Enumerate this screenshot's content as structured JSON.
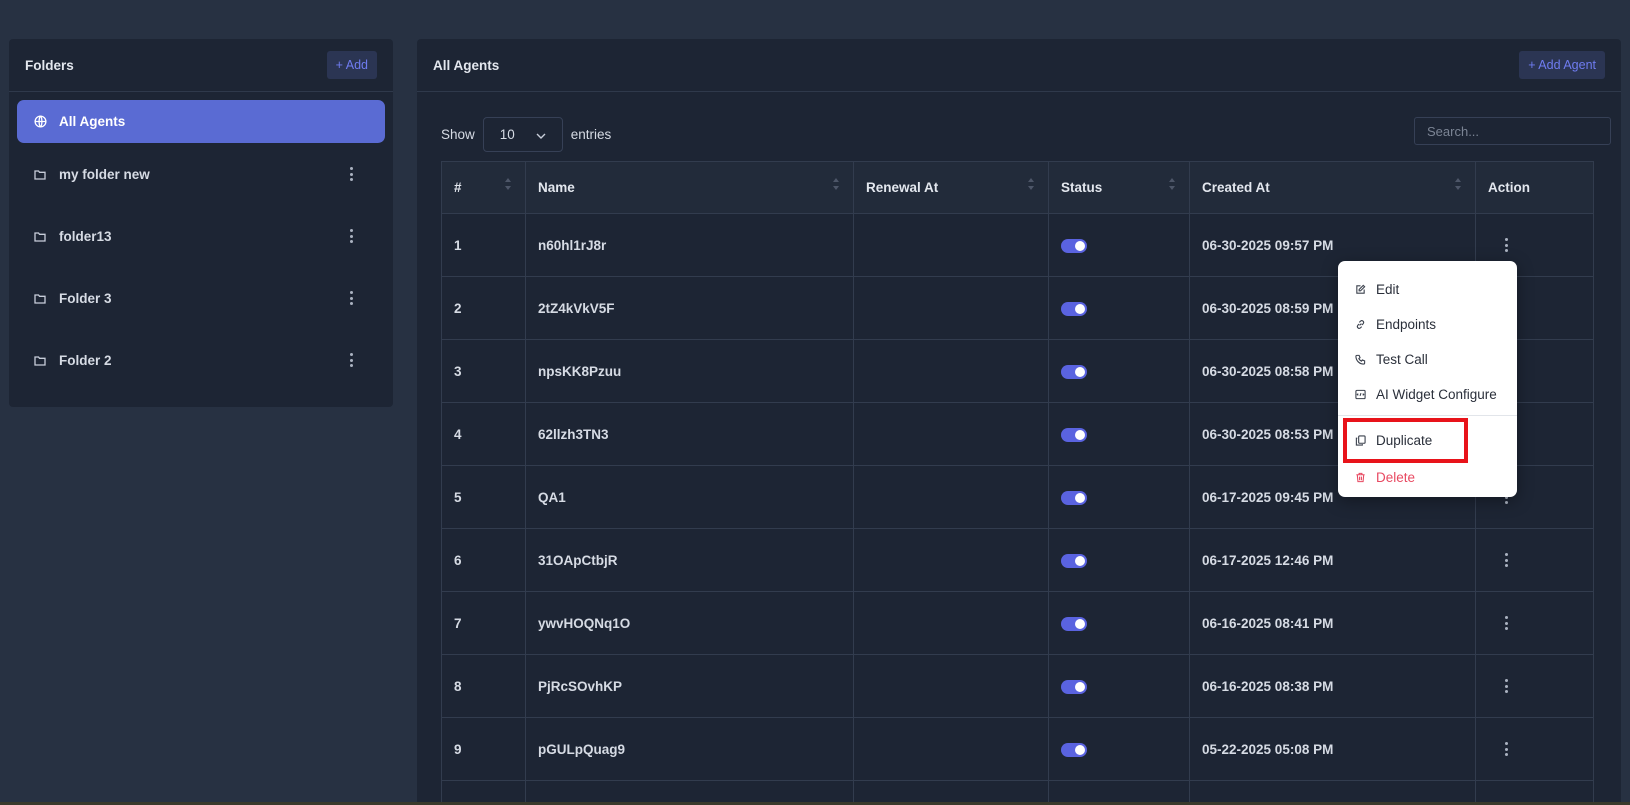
{
  "folders": {
    "title": "Folders",
    "add_label": "+ Add",
    "items": [
      {
        "label": "All Agents",
        "active": true
      },
      {
        "label": "my folder new"
      },
      {
        "label": "folder13"
      },
      {
        "label": "Folder 3"
      },
      {
        "label": "Folder 2"
      }
    ]
  },
  "agents": {
    "title": "All Agents",
    "add_label": "+ Add Agent",
    "show_label": "Show",
    "entries_value": "10",
    "entries_label": "entries",
    "search_placeholder": "Search...",
    "columns": [
      "#",
      "Name",
      "Renewal At",
      "Status",
      "Created At",
      "Action"
    ],
    "rows": [
      {
        "num": "1",
        "name": "n60hl1rJ8r",
        "renewal": "",
        "created": "06-30-2025 09:57 PM"
      },
      {
        "num": "2",
        "name": "2tZ4kVkV5F",
        "renewal": "",
        "created": "06-30-2025 08:59 PM"
      },
      {
        "num": "3",
        "name": "npsKK8Pzuu",
        "renewal": "",
        "created": "06-30-2025 08:58 PM"
      },
      {
        "num": "4",
        "name": "62llzh3TN3",
        "renewal": "",
        "created": "06-30-2025 08:53 PM"
      },
      {
        "num": "5",
        "name": "QA1",
        "renewal": "",
        "created": "06-17-2025 09:45 PM"
      },
      {
        "num": "6",
        "name": "31OApCtbjR",
        "renewal": "",
        "created": "06-17-2025 12:46 PM"
      },
      {
        "num": "7",
        "name": "ywvHOQNq1O",
        "renewal": "",
        "created": "06-16-2025 08:41 PM"
      },
      {
        "num": "8",
        "name": "PjRcSOvhKP",
        "renewal": "",
        "created": "06-16-2025 08:38 PM"
      },
      {
        "num": "9",
        "name": "pGULpQuag9",
        "renewal": "",
        "created": "05-22-2025 05:08 PM"
      },
      {
        "num": "",
        "name": "",
        "renewal": "",
        "created": ""
      }
    ]
  },
  "action_menu": {
    "items": [
      {
        "label": "Edit",
        "icon": "edit-icon"
      },
      {
        "label": "Endpoints",
        "icon": "link-icon"
      },
      {
        "label": "Test Call",
        "icon": "phone-icon"
      },
      {
        "label": "AI Widget Configure",
        "icon": "widget-icon"
      },
      {
        "label": "Duplicate",
        "icon": "copy-icon"
      },
      {
        "label": "Delete",
        "icon": "trash-icon"
      }
    ]
  },
  "colors": {
    "accent": "#5a6bd3",
    "toggle": "#5a63e0",
    "danger": "#e84a62",
    "highlight": "#e8131a"
  }
}
